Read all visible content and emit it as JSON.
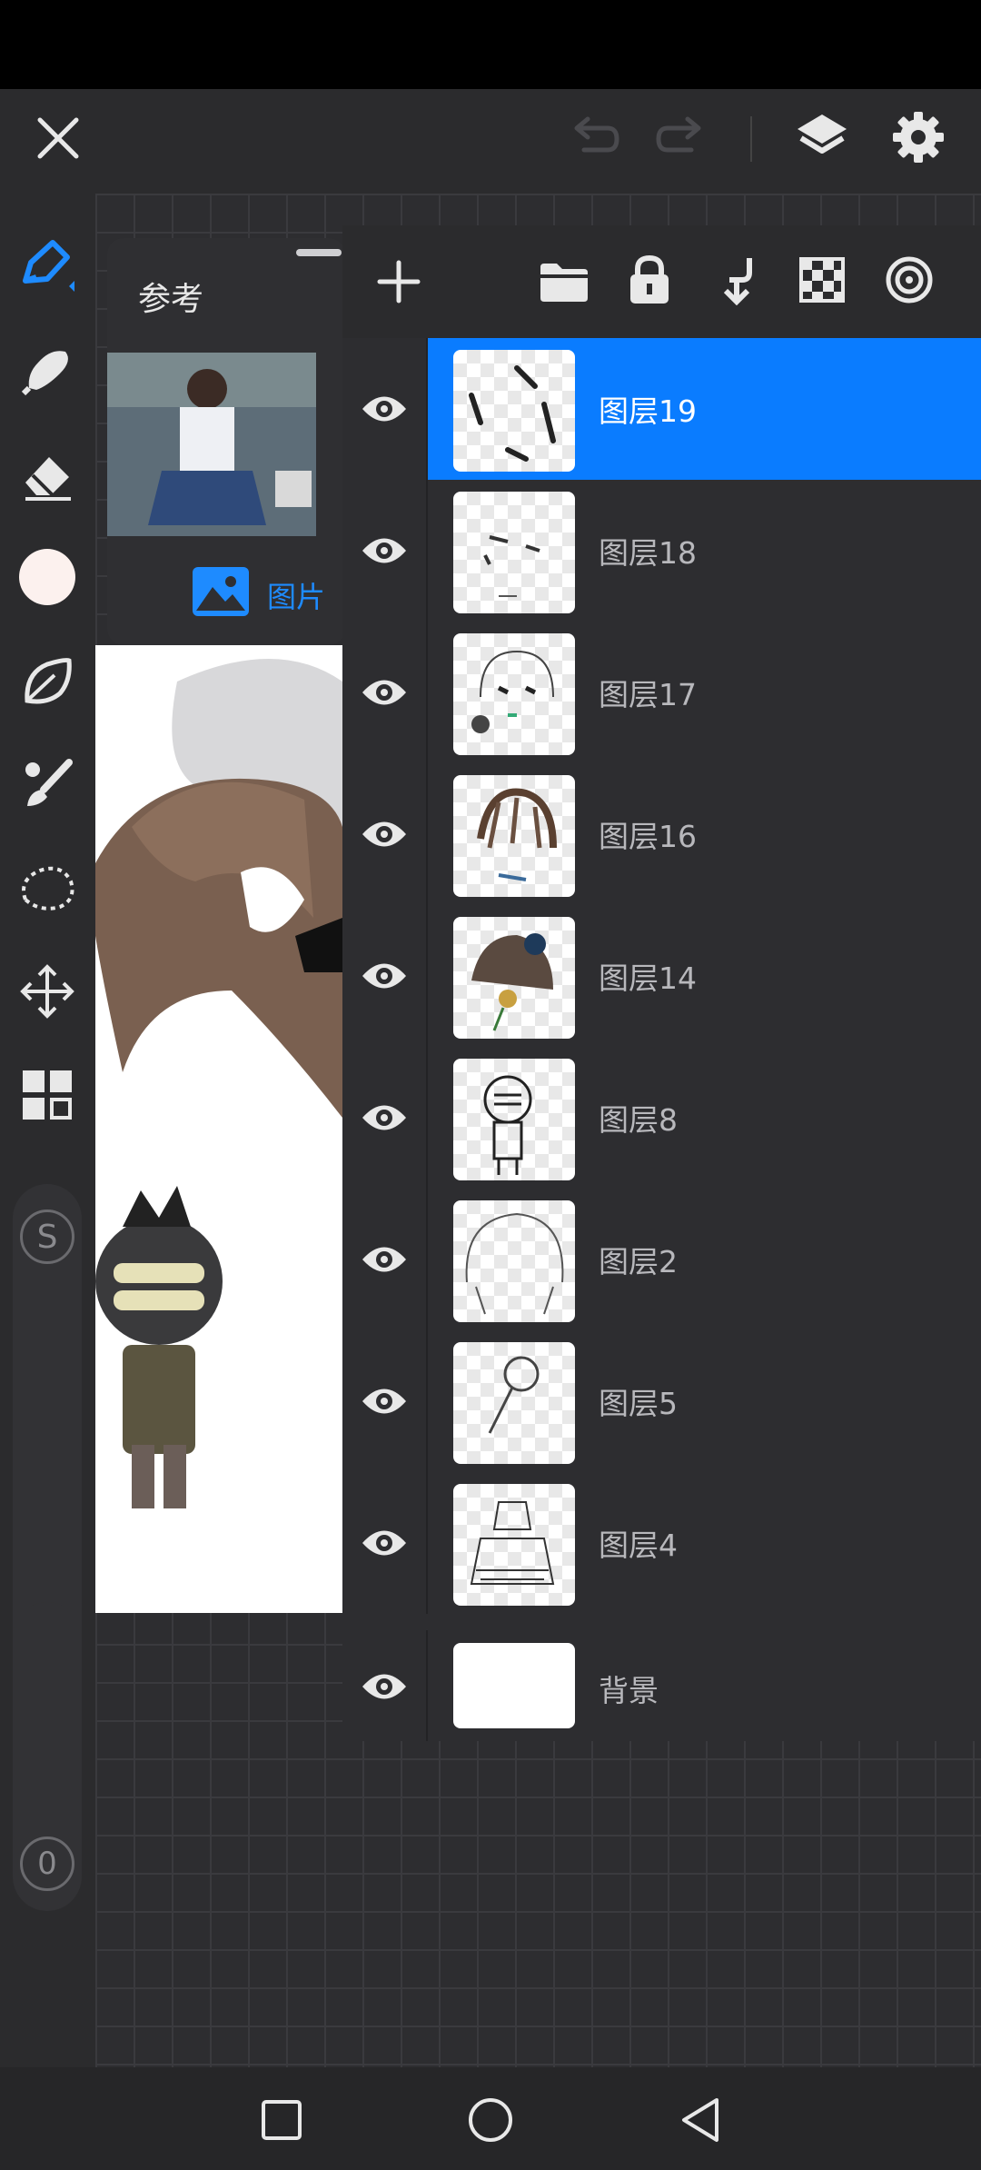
{
  "colors": {
    "accent": "#0a7cff",
    "panel": "#2d2d30",
    "toolbar": "#2b2b2d"
  },
  "toolbar": {
    "icons": [
      "close-icon",
      "undo-icon",
      "redo-icon",
      "layers-icon",
      "settings-icon"
    ]
  },
  "left_tools": [
    "brush-icon",
    "smudge-icon",
    "eraser-icon",
    "color-swatch",
    "leaf-icon",
    "paintbrush-icon",
    "lasso-icon",
    "move-icon",
    "grid-icon",
    "s-icon"
  ],
  "brush_size_label": "0",
  "reference": {
    "title": "参考",
    "tab_label": "图片"
  },
  "layer_toolbar": [
    "add-icon",
    "folder-icon",
    "lock-icon",
    "merge-down-icon",
    "checker-icon",
    "target-icon"
  ],
  "layers": [
    {
      "name": "图层19",
      "selected": true
    },
    {
      "name": "图层18",
      "selected": false
    },
    {
      "name": "图层17",
      "selected": false
    },
    {
      "name": "图层16",
      "selected": false
    },
    {
      "name": "图层14",
      "selected": false
    },
    {
      "name": "图层8",
      "selected": false
    },
    {
      "name": "图层2",
      "selected": false
    },
    {
      "name": "图层5",
      "selected": false
    },
    {
      "name": "图层4",
      "selected": false
    }
  ],
  "background_layer": {
    "name": "背景"
  },
  "navbar": [
    "recents-icon",
    "home-icon",
    "back-icon"
  ]
}
